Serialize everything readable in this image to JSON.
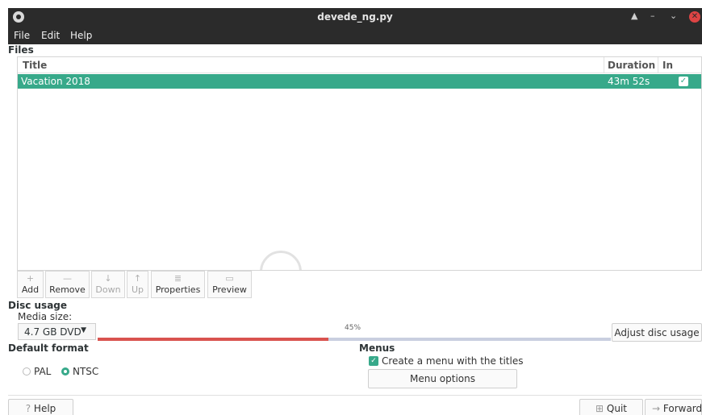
{
  "window": {
    "title": "devede_ng.py",
    "controls": {
      "up": "▲",
      "minimize": "–",
      "restore": "⌄",
      "close": "✕"
    }
  },
  "menubar": [
    "File",
    "Edit",
    "Help"
  ],
  "files": {
    "label": "Files",
    "columns": {
      "title": "Title",
      "duration": "Duration",
      "in_menu": "In menu"
    },
    "rows": [
      {
        "title": "Vacation 2018",
        "duration": "43m 52s",
        "in_menu": true
      }
    ],
    "selected_row_color": "#37a98a"
  },
  "toolbar": {
    "add": {
      "label": "Add",
      "icon": "plus-icon",
      "glyph": "+"
    },
    "remove": {
      "label": "Remove",
      "icon": "minus-icon",
      "glyph": "—"
    },
    "down": {
      "label": "Down",
      "icon": "arrow-down-icon",
      "glyph": "↓"
    },
    "up": {
      "label": "Up",
      "icon": "arrow-up-icon",
      "glyph": "↑"
    },
    "properties": {
      "label": "Properties",
      "icon": "list-icon",
      "glyph": "≣"
    },
    "preview": {
      "label": "Preview",
      "icon": "monitor-icon",
      "glyph": "▭"
    }
  },
  "disc_usage": {
    "label": "Disc usage",
    "media_size_label": "Media size:",
    "media_size_value": "4.7 GB DVD",
    "usage_percent_text": "45%",
    "usage_fraction": 0.45,
    "adjust_button": "Adjust disc usage",
    "fill_color": "#d9534f",
    "track_color": "#c9cfe0"
  },
  "default_format": {
    "label": "Default format",
    "options": [
      "PAL",
      "NTSC"
    ],
    "selected": "NTSC"
  },
  "menus": {
    "label": "Menus",
    "create_menu_label": "Create a menu with the titles",
    "create_menu_checked": true,
    "menu_options_button": "Menu options"
  },
  "footer": {
    "help": "Help",
    "quit": "Quit",
    "forward": "Forward",
    "help_glyph": "?",
    "quit_glyph": "⊞",
    "forward_glyph": "→"
  }
}
